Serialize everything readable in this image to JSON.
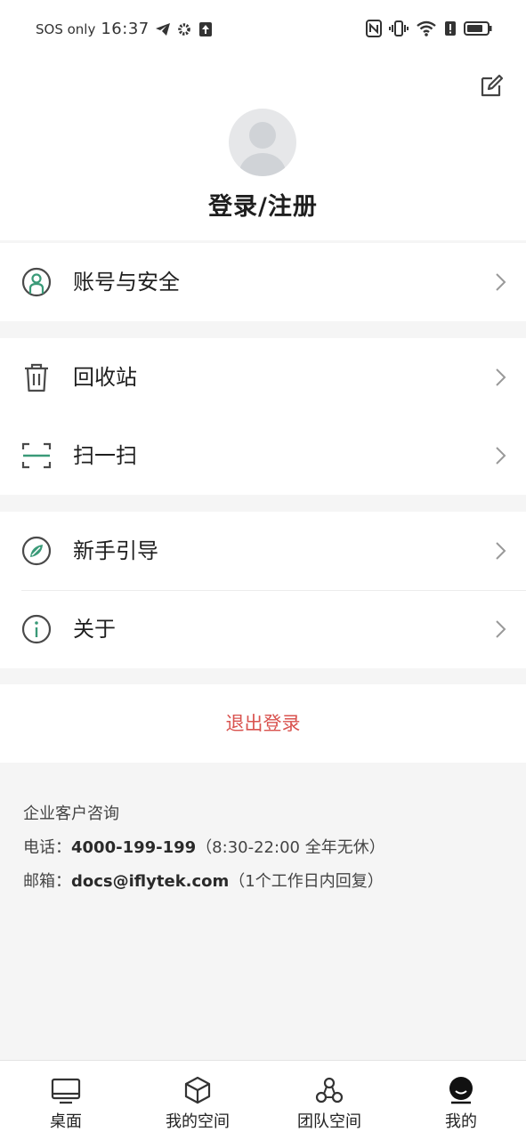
{
  "status_bar": {
    "carrier": "SOS only",
    "time": "16:37"
  },
  "header": {
    "login_label": "登录/注册"
  },
  "menu": {
    "account": "账号与安全",
    "recycle": "回收站",
    "scan": "扫一扫",
    "guide": "新手引导",
    "about": "关于"
  },
  "logout_label": "退出登录",
  "contact": {
    "heading": "企业客户咨询",
    "phone_prefix": "电话：",
    "phone_number": "4000-199-199",
    "phone_hours": "（8:30-22:00 全年无休）",
    "email_prefix": "邮箱：",
    "email_address": "docs@iflytek.com",
    "email_note": "（1个工作日内回复）"
  },
  "tabs": [
    "桌面",
    "我的空间",
    "团队空间",
    "我的"
  ],
  "colors": {
    "accent_green": "#3a9a78",
    "logout_red": "#d9534f",
    "icon_dark": "#4a4a4a"
  },
  "icons": [
    "edit-icon",
    "user-shield-icon",
    "trash-icon",
    "scan-icon",
    "compass-icon",
    "info-icon",
    "chevron-right-icon",
    "desktop-icon",
    "cube-icon",
    "team-icon",
    "profile-icon"
  ]
}
